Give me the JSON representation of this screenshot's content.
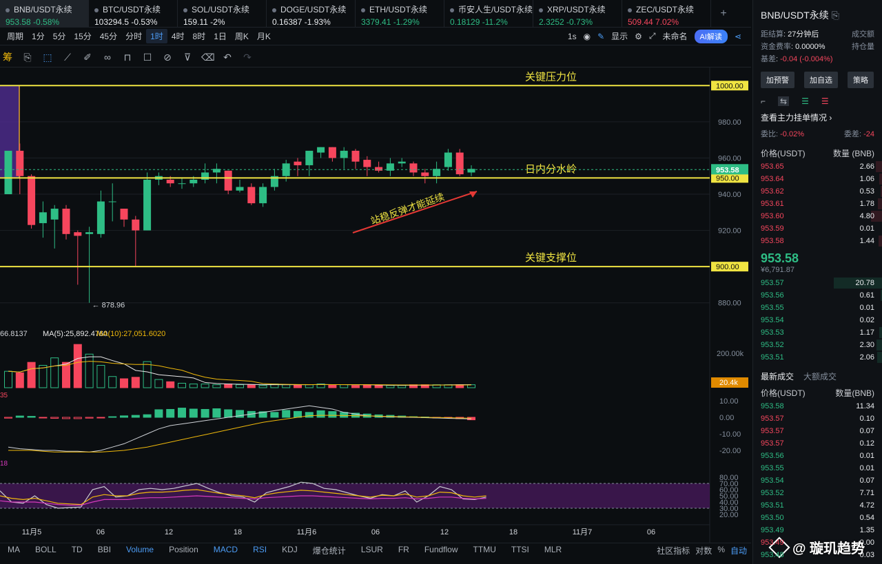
{
  "tabs": [
    {
      "name": "BNB/USDT永续",
      "price": "953.58",
      "change": "-0.58%",
      "dir": "green",
      "active": true
    },
    {
      "name": "BTC/USDT永续",
      "price": "103294.5",
      "change": "-0.53%",
      "dir": "white"
    },
    {
      "name": "SOL/USDT永续",
      "price": "159.11",
      "change": "-2%",
      "dir": "white"
    },
    {
      "name": "DOGE/USDT永续",
      "price": "0.16387",
      "change": "-1.93%",
      "dir": "white"
    },
    {
      "name": "ETH/USDT永续",
      "price": "3379.41",
      "change": "-1.29%",
      "dir": "green"
    },
    {
      "name": "币安人生/USDT永续",
      "price": "0.18129",
      "change": "-11.2%",
      "dir": "green"
    },
    {
      "name": "XRP/USDT永续",
      "price": "2.3252",
      "change": "-0.73%",
      "dir": "green"
    },
    {
      "name": "ZEC/USDT永续",
      "price": "509.44",
      "change": "7.02%",
      "dir": "red"
    }
  ],
  "toolbar": {
    "period_label": "周期",
    "timeframes": [
      "1分",
      "5分",
      "15分",
      "45分",
      "分时",
      "1时",
      "4时",
      "8时",
      "1日",
      "周K",
      "月K"
    ],
    "active_timeframe": "1时",
    "refresh": "1s",
    "display": "显示",
    "layout_name": "未命名",
    "ai_label": "AI解读"
  },
  "drawbar": {
    "left_glyph": "筹"
  },
  "chart_data": [
    {
      "type": "candlestick",
      "title": "BNB/USDT永续",
      "y_ticks": [
        1000,
        980,
        960,
        940,
        920,
        900,
        880
      ],
      "ylim": [
        870,
        1010
      ],
      "x_ticks": [
        "11月5",
        "06",
        "12",
        "18",
        "11月6",
        "06",
        "12",
        "18",
        "11月7",
        "06"
      ],
      "last_price": "953.58",
      "low_marker": "878.96",
      "candles": [
        [
          940,
          964,
          944,
          954
        ],
        [
          964,
          950,
          968,
          940
        ],
        [
          950,
          923,
          951,
          921
        ],
        [
          924,
          930,
          936,
          916
        ],
        [
          926,
          932,
          934,
          910
        ],
        [
          932,
          918,
          934,
          915
        ],
        [
          919,
          917,
          920,
          890
        ],
        [
          918,
          919,
          922,
          880
        ],
        [
          918,
          936,
          942,
          916
        ],
        [
          936,
          936,
          946,
          925
        ],
        [
          932,
          926,
          932,
          922
        ],
        [
          926,
          920,
          928,
          900
        ],
        [
          920,
          948,
          952,
          920
        ],
        [
          948,
          950,
          952,
          945
        ],
        [
          948,
          946,
          950,
          944
        ],
        [
          946,
          946,
          949,
          943
        ],
        [
          946,
          948,
          950,
          944
        ],
        [
          948,
          952,
          957,
          946
        ],
        [
          952,
          954,
          957,
          946
        ],
        [
          953,
          942,
          953,
          940
        ],
        [
          942,
          944,
          948,
          941
        ],
        [
          944,
          935,
          946,
          934
        ],
        [
          935,
          944,
          946,
          933
        ],
        [
          944,
          950,
          954,
          942
        ],
        [
          950,
          957,
          959,
          947
        ],
        [
          958,
          956,
          960,
          950
        ],
        [
          956,
          964,
          964,
          950
        ],
        [
          963,
          966,
          966,
          960
        ],
        [
          966,
          960,
          966,
          958
        ],
        [
          960,
          964,
          966,
          954
        ],
        [
          964,
          958,
          965,
          954
        ],
        [
          959,
          955,
          961,
          950
        ],
        [
          955,
          953,
          958,
          952
        ],
        [
          953,
          957,
          960,
          950
        ],
        [
          957,
          958,
          960,
          955
        ],
        [
          957,
          952,
          958,
          950
        ],
        [
          952,
          950,
          954,
          946
        ],
        [
          950,
          954,
          958,
          946
        ],
        [
          955,
          963,
          965,
          953
        ],
        [
          963,
          951,
          965,
          950
        ],
        [
          952,
          954,
          956,
          950
        ]
      ],
      "levels": [
        {
          "price": 1000,
          "label": "关键压力位",
          "tag": "1000.00"
        },
        {
          "price": 949,
          "label": "日内分水岭",
          "tag": "950.00"
        },
        {
          "price": 900,
          "label": "关键支撑位",
          "tag": "900.00"
        }
      ],
      "annotation": "站稳反弹才能延续"
    },
    {
      "type": "bar",
      "title": "Volume",
      "legend": [
        {
          "name": "66.8137",
          "color": "#d0d3d8"
        },
        {
          "name": "MA(5):25,892.4760",
          "color": "#e9e9e9"
        },
        {
          "name": "MA(10):27,051.6020",
          "color": "#f0b90b"
        }
      ],
      "y_ticks": [
        "200.00k"
      ],
      "last_tag": "20.4k",
      "values": [
        22,
        20,
        34,
        30,
        40,
        34,
        58,
        45,
        30,
        15,
        12,
        14,
        35,
        11,
        8,
        6,
        5,
        5,
        4,
        5,
        4,
        4,
        3,
        5,
        4,
        4,
        4,
        5,
        4,
        4,
        3,
        4,
        3,
        3,
        3,
        4,
        4,
        4,
        4,
        4,
        4
      ]
    },
    {
      "type": "bar",
      "title": "MACD",
      "left_value": "35",
      "y_ticks": [
        "10.00",
        "0.00",
        "-10.00",
        "-20.00"
      ],
      "values": [
        -0.5,
        0.8,
        0.6,
        -0.3,
        -0.6,
        -0.8,
        -0.8,
        -0.5,
        -0.2,
        0.4,
        0.9,
        1.2,
        1.6,
        4.6,
        4.8,
        5.6,
        5.0,
        4.8,
        5.2,
        4.6,
        4.2,
        3.6,
        3.4,
        3.0,
        4.2,
        3.6,
        3.0,
        4.0,
        3.5,
        3.0,
        2.5,
        2.0,
        1.5,
        1.2,
        0.8,
        0.4,
        0.2,
        -0.2,
        -0.4,
        -0.8,
        -1.5
      ],
      "dif": [
        -18,
        -19,
        -19.5,
        -20,
        -20,
        -20.5,
        -20.5,
        -21,
        -20,
        -18,
        -16,
        -13,
        -10,
        -7,
        -5,
        -4,
        -3,
        -2,
        -1,
        0,
        1,
        2,
        3,
        4,
        5,
        6,
        7,
        6,
        5,
        3,
        2,
        1,
        0.5,
        0.3,
        0.1,
        0,
        -0.2,
        -0.4,
        -0.6,
        -0.8,
        -1
      ],
      "dea": [
        -20,
        -20,
        -20,
        -20.5,
        -21,
        -21,
        -21,
        -21,
        -21,
        -20.5,
        -20,
        -19,
        -18,
        -16.5,
        -15,
        -13.5,
        -12,
        -10.5,
        -9,
        -7.5,
        -6,
        -4.5,
        -3,
        -2,
        -1,
        0,
        1,
        1.2,
        1.2,
        1.1,
        1,
        0.9,
        0.7,
        0.5,
        0.3,
        0.2,
        0,
        -0.1,
        -0.2,
        -0.4,
        -0.5
      ]
    },
    {
      "type": "line",
      "title": "RSI",
      "left_value": "18",
      "y_ticks": [
        "80.00",
        "70.00",
        "60.00",
        "50.00",
        "40.00",
        "30.00",
        "20.00"
      ],
      "band": [
        30,
        70
      ],
      "series": [
        {
          "name": "",
          "color": "#c9ccd1",
          "values": [
            58,
            40,
            38,
            50,
            36,
            30,
            31,
            32,
            60,
            65,
            48,
            50,
            60,
            62,
            60,
            62,
            66,
            70,
            62,
            55,
            50,
            48,
            40,
            55,
            60,
            65,
            72,
            70,
            62,
            60,
            55,
            50,
            46,
            52,
            50,
            58,
            40,
            50,
            65,
            60,
            45,
            44,
            48
          ]
        },
        {
          "name": "",
          "color": "#f0b90b",
          "values": [
            50,
            46,
            44,
            46,
            42,
            38,
            37,
            36,
            48,
            52,
            50,
            50,
            54,
            56,
            56,
            57,
            59,
            60,
            57,
            54,
            52,
            50,
            47,
            52,
            55,
            57,
            59,
            58,
            56,
            54,
            52,
            50,
            48,
            51,
            50,
            53,
            48,
            50,
            56,
            55,
            50,
            48,
            50
          ]
        },
        {
          "name": "",
          "color": "#d63abd",
          "values": [
            42,
            40,
            40,
            40,
            38,
            36,
            35,
            35,
            40,
            44,
            44,
            44,
            46,
            47,
            47,
            48,
            49,
            50,
            49,
            48,
            47,
            46,
            45,
            47,
            48,
            49,
            50,
            50,
            49,
            48,
            47,
            46,
            45,
            46,
            46,
            47,
            45,
            46,
            48,
            48,
            46,
            45,
            46
          ]
        }
      ]
    }
  ],
  "bottombar": {
    "indicators": [
      {
        "label": "MA",
        "on": false
      },
      {
        "label": "BOLL",
        "on": false
      },
      {
        "label": "TD",
        "on": false
      },
      {
        "label": "BBI",
        "on": false
      },
      {
        "label": "Volume",
        "on": true
      },
      {
        "label": "Position",
        "on": false
      },
      {
        "label": "MACD",
        "on": true
      },
      {
        "label": "RSI",
        "on": true
      },
      {
        "label": "KDJ",
        "on": false
      },
      {
        "label": "爆仓统计",
        "on": false
      },
      {
        "label": "LSUR",
        "on": false
      },
      {
        "label": "FR",
        "on": false
      },
      {
        "label": "Fundflow",
        "on": false
      },
      {
        "label": "TTMU",
        "on": false
      },
      {
        "label": "TTSI",
        "on": false
      },
      {
        "label": "MLR",
        "on": false
      }
    ],
    "right": [
      "社区指标",
      "对数",
      "%",
      "自动"
    ]
  },
  "sidebar": {
    "title": "BNB/USDT永续",
    "settle_label": "距结算",
    "settle_value": "27分钟后",
    "volume_label": "成交额",
    "funding_label": "资金费率",
    "funding_value": "0.0000%",
    "position_label": "持仓量",
    "basis_label": "基差",
    "basis_value": "-0.04 (-0.004%)",
    "buttons": [
      "加预警",
      "加自选",
      "策略"
    ],
    "orderbook_link": "查看主力挂单情况",
    "ratio_label": "委比:",
    "ratio_value": "-0.02%",
    "diff_label": "委差:",
    "diff_value": "-24",
    "col_price": "价格(USDT)",
    "col_qty": "数量 (BNB)",
    "asks": [
      [
        "953.65",
        "2.66"
      ],
      [
        "953.64",
        "1.06"
      ],
      [
        "953.62",
        "0.53"
      ],
      [
        "953.61",
        "1.78"
      ],
      [
        "953.60",
        "4.80"
      ],
      [
        "953.59",
        "0.01"
      ],
      [
        "953.58",
        "1.44"
      ]
    ],
    "mid_price": "953.58",
    "mid_sub": "¥6,791.87",
    "bids": [
      [
        "953.57",
        "20.78"
      ],
      [
        "953.56",
        "0.61"
      ],
      [
        "953.55",
        "0.01"
      ],
      [
        "953.54",
        "0.02"
      ],
      [
        "953.53",
        "1.17"
      ],
      [
        "953.52",
        "2.30"
      ],
      [
        "953.51",
        "2.06"
      ]
    ],
    "trade_tab_latest": "最新成交",
    "trade_tab_large": "大额成交",
    "trade_col_price": "价格(USDT)",
    "trade_col_qty": "数量(BNB)",
    "trades": [
      [
        "953.58",
        "11.34",
        "green"
      ],
      [
        "953.57",
        "0.10",
        "red"
      ],
      [
        "953.57",
        "0.07",
        "red"
      ],
      [
        "953.57",
        "0.12",
        "red"
      ],
      [
        "953.56",
        "0.01",
        "green"
      ],
      [
        "953.55",
        "0.01",
        "green"
      ],
      [
        "953.54",
        "0.07",
        "green"
      ],
      [
        "953.52",
        "7.71",
        "green"
      ],
      [
        "953.51",
        "4.72",
        "green"
      ],
      [
        "953.50",
        "0.54",
        "green"
      ],
      [
        "953.49",
        "1.35",
        "green"
      ],
      [
        "953.49",
        "0.00",
        "red"
      ],
      [
        "953.48",
        "0.03",
        "green"
      ]
    ]
  },
  "watermark": "@ 璇玑趋势",
  "colors": {
    "up": "#2ebd85",
    "down": "#f6465d",
    "level": "#f0e442",
    "accent": "#4c9cf5"
  }
}
